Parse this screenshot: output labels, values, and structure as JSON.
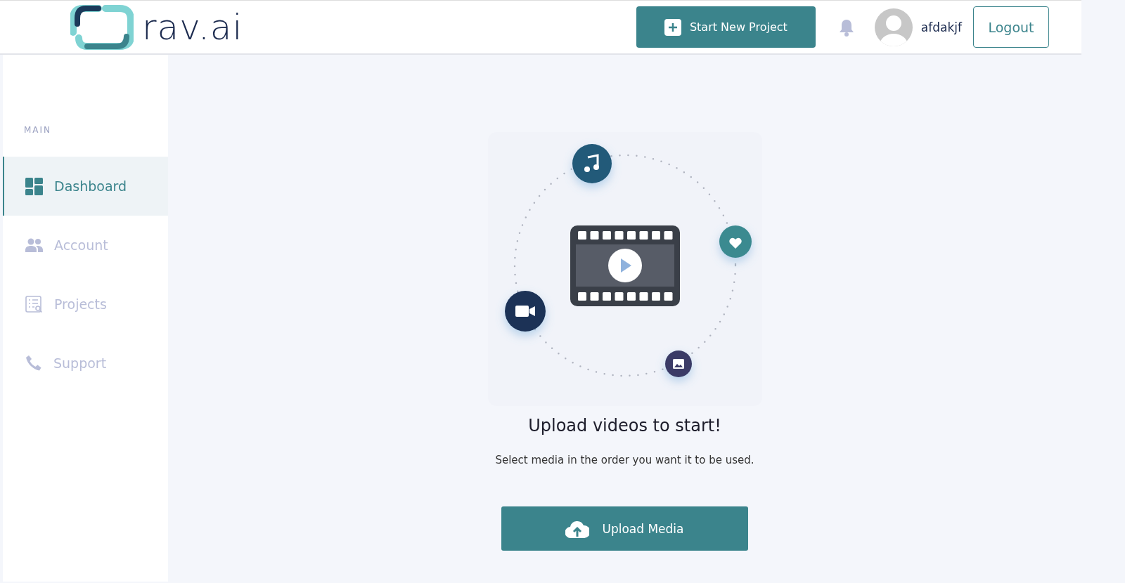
{
  "header": {
    "logo_text": "rav.ai",
    "new_project_button": "Start New Project",
    "username": "afdakjf",
    "logout_button": "Logout"
  },
  "sidebar": {
    "section_label": "MAIN",
    "items": [
      {
        "label": "Dashboard",
        "kind": "grid",
        "selected": true
      },
      {
        "label": "Account",
        "kind": "people",
        "selected": false
      },
      {
        "label": "Projects",
        "kind": "list",
        "selected": false
      },
      {
        "label": "Support",
        "kind": "phone",
        "selected": false
      }
    ]
  },
  "main": {
    "title": "Upload videos to start!",
    "subtitle": "Select media in the order you want it to be used.",
    "upload_button": "Upload Media"
  }
}
